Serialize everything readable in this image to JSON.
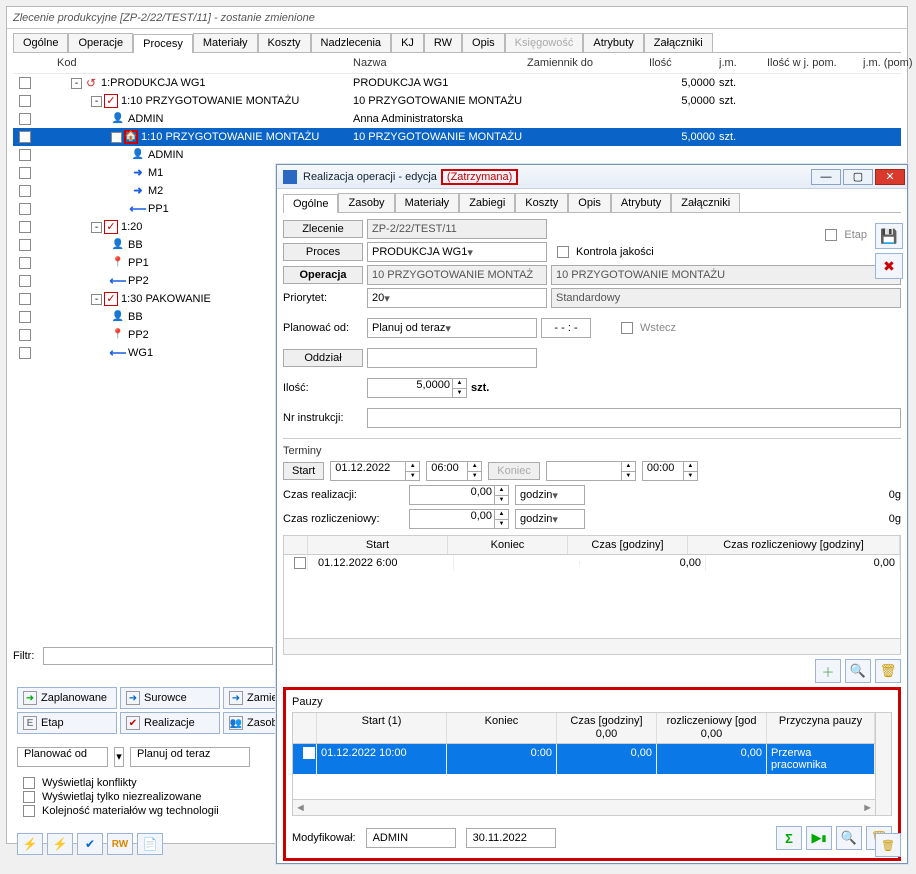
{
  "main": {
    "title": "Zlecenie produkcyjne  [ZP-2/22/TEST/11] - zostanie zmienione",
    "tabs": [
      "Ogólne",
      "Operacje",
      "Procesy",
      "Materiały",
      "Koszty",
      "Nadzlecenia",
      "KJ",
      "RW",
      "Opis",
      "Księgowość",
      "Atrybuty",
      "Załączniki"
    ],
    "tabs_active_index": 2,
    "tabs_disabled_index": 9,
    "cols": {
      "kod": "Kod",
      "nazwa": "Nazwa",
      "zam": "Zamiennik do",
      "ilosc": "Ilość",
      "jm": "j.m.",
      "ilosc_pom": "Ilość w j. pom.",
      "jm_pom": "j.m. (pom)"
    },
    "rows": [
      {
        "indent": 0,
        "exp": "-",
        "icon": "cyc",
        "kod": "1:PRODUKCJA WG1",
        "nazwa": "PRODUKCJA WG1",
        "ilosc": "5,0000",
        "jm": "szt."
      },
      {
        "indent": 1,
        "exp": "-",
        "icon": "red-check",
        "kod": "1:10 PRZYGOTOWANIE MONTAŻU",
        "nazwa": "10 PRZYGOTOWANIE MONTAŻU",
        "ilosc": "5,0000",
        "jm": "szt."
      },
      {
        "indent": 2,
        "icon": "person",
        "kod": "ADMIN",
        "nazwa": "Anna Administratorska"
      },
      {
        "indent": 2,
        "exp": "-",
        "icon": "green-home",
        "kod": "1:10 PRZYGOTOWANIE MONTAŻU",
        "nazwa": "10 PRZYGOTOWANIE MONTAŻU",
        "ilosc": "5,0000",
        "jm": "szt.",
        "sel": true
      },
      {
        "indent": 3,
        "icon": "person",
        "kod": "ADMIN"
      },
      {
        "indent": 3,
        "icon": "arr-r",
        "kod": "M1"
      },
      {
        "indent": 3,
        "icon": "arr-r",
        "kod": "M2"
      },
      {
        "indent": 3,
        "icon": "arr-l",
        "kod": "PP1"
      },
      {
        "indent": 1,
        "exp": "-",
        "icon": "red-check",
        "kod": "1:20"
      },
      {
        "indent": 2,
        "icon": "person",
        "kod": "BB"
      },
      {
        "indent": 2,
        "icon": "pin",
        "kod": "PP1"
      },
      {
        "indent": 2,
        "icon": "arr-l",
        "kod": "PP2"
      },
      {
        "indent": 1,
        "exp": "-",
        "icon": "red-check",
        "kod": "1:30 PAKOWANIE"
      },
      {
        "indent": 2,
        "icon": "person",
        "kod": "BB"
      },
      {
        "indent": 2,
        "icon": "pin",
        "kod": "PP2"
      },
      {
        "indent": 2,
        "icon": "arr-l",
        "kod": "WG1"
      }
    ],
    "filtr_label": "Filtr:",
    "btns": [
      "Zaplanowane",
      "Surowce",
      "Zamienn",
      "Etap",
      "Realizacje",
      "Zasoby"
    ],
    "plan_from_btn": "Planować od",
    "plan_from_val": "Planuj od teraz",
    "checks": [
      "Wyświetlaj konflikty",
      "Wyświetlaj tylko niezrealizowane",
      "Kolejność materiałów wg technologii"
    ]
  },
  "dlg": {
    "title_pre": "Realizacja operacji - edycja",
    "title_status": "(Zatrzymana)",
    "tabs": [
      "Ogólne",
      "Zasoby",
      "Materiały",
      "Zabiegi",
      "Koszty",
      "Opis",
      "Atrybuty",
      "Załączniki"
    ],
    "tabs_active_index": 0,
    "f": {
      "zlecenie_l": "Zlecenie",
      "zlecenie_v": "ZP-2/22/TEST/11",
      "proces_l": "Proces",
      "proces_v": "PRODUKCJA WG1",
      "kj_l": "Kontrola jakości",
      "oper_l": "Operacja",
      "oper_v1": "10 PRZYGOTOWANIE MONTAŻ",
      "oper_v2": "10 PRZYGOTOWANIE MONTAŻU",
      "prio_l": "Priorytet:",
      "prio_v": "20",
      "prio_std": "Standardowy",
      "etap_l": "Etap",
      "planod_l": "Planować od:",
      "planod_v": "Planuj od teraz",
      "planod_time": "- - : -",
      "wstecz_l": "Wstecz",
      "oddzial_l": "Oddział",
      "ilosc_l": "Ilość:",
      "ilosc_v": "5,0000",
      "ilosc_u": "szt.",
      "nrinstr_l": "Nr instrukcji:"
    },
    "term": {
      "legend": "Terminy",
      "start_l": "Start",
      "start_d": "01.12.2022",
      "start_t": "06:00",
      "koniec_l": "Koniec",
      "koniec_t": "00:00",
      "czasreal_l": "Czas realizacji:",
      "czasreal_v": "0,00",
      "czasreal_u": "godzin",
      "czasreal_r": "0g",
      "czasroz_l": "Czas rozliczeniowy:",
      "czasroz_v": "0,00",
      "czasroz_u": "godzin",
      "czasroz_r": "0g",
      "grid_h": [
        "Start",
        "Koniec",
        "Czas [godziny]",
        "Czas rozliczeniowy [godziny]"
      ],
      "grid_r": {
        "start": "01.12.2022   6:00",
        "koniec": "",
        "czas": "0,00",
        "rozl": "0,00"
      }
    },
    "pauzy": {
      "legend": "Pauzy",
      "h": [
        "Start (1)",
        "Koniec",
        "Czas [godziny]\n0,00",
        "rozliczeniowy [god\n0,00",
        "Przyczyna pauzy"
      ],
      "r": {
        "start": "01.12.2022     10:00",
        "koniec": "0:00",
        "czas": "0,00",
        "rozl": "0,00",
        "reason": "Przerwa pracownika"
      }
    },
    "mod": {
      "l": "Modyfikował:",
      "who": "ADMIN",
      "when": "30.11.2022"
    }
  }
}
